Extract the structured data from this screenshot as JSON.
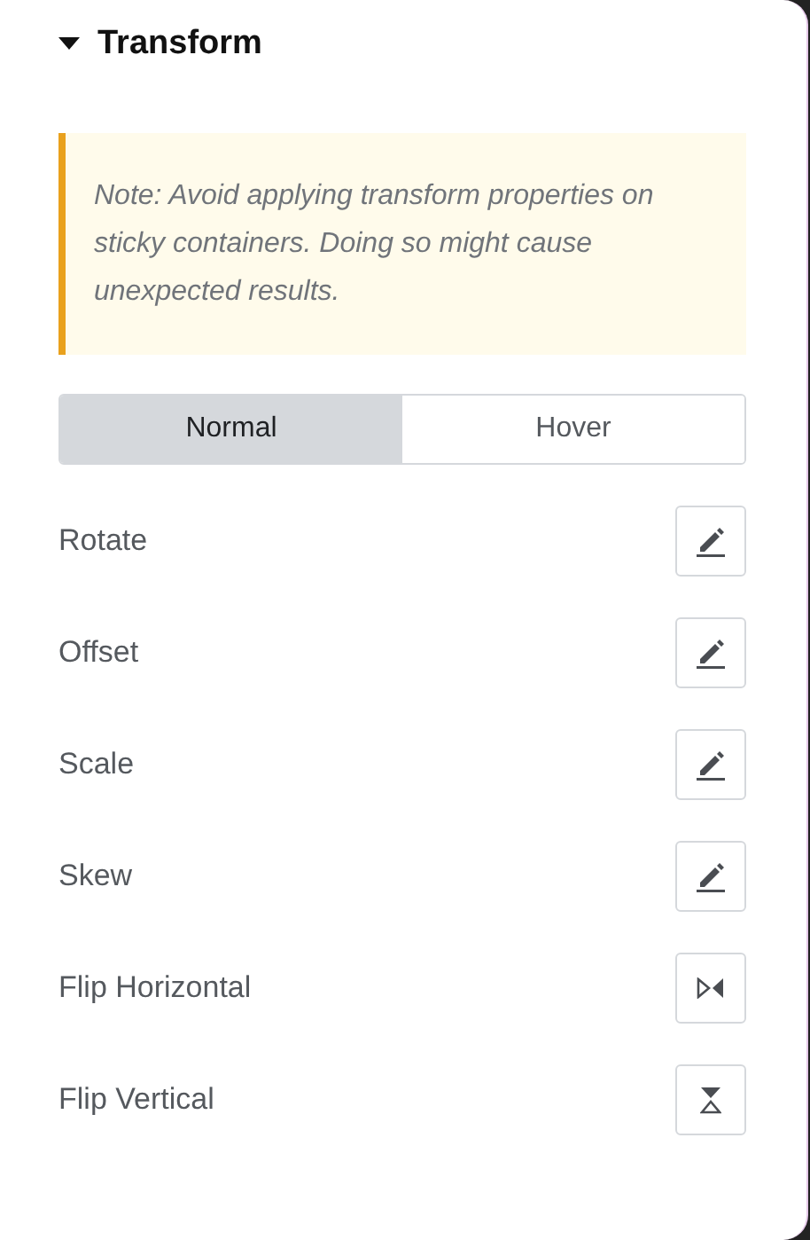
{
  "section": {
    "title": "Transform",
    "expanded": true
  },
  "note": "Note: Avoid applying transform properties on sticky containers. Doing so might cause unexpected results.",
  "tabs": [
    {
      "label": "Normal",
      "selected": true
    },
    {
      "label": "Hover",
      "selected": false
    }
  ],
  "controls": [
    {
      "label": "Rotate",
      "kind": "edit"
    },
    {
      "label": "Offset",
      "kind": "edit"
    },
    {
      "label": "Scale",
      "kind": "edit"
    },
    {
      "label": "Skew",
      "kind": "edit"
    },
    {
      "label": "Flip Horizontal",
      "kind": "flip-h"
    },
    {
      "label": "Flip Vertical",
      "kind": "flip-v"
    }
  ]
}
